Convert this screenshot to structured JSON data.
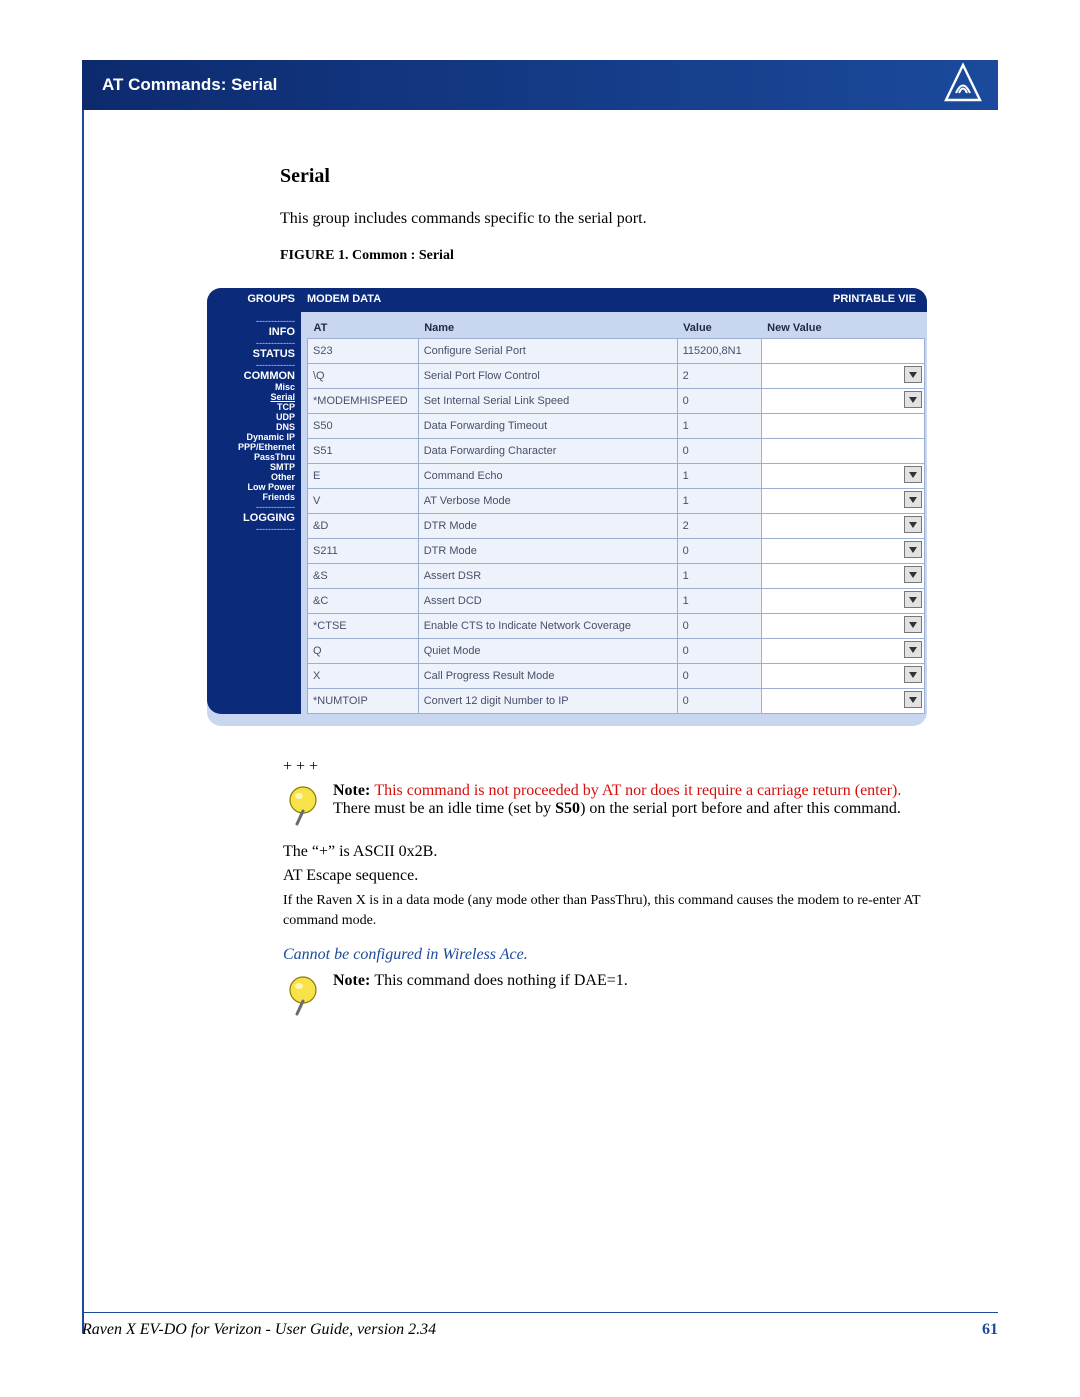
{
  "header": {
    "title": "AT Commands: Serial"
  },
  "section": {
    "heading": "Serial",
    "intro": "This group includes commands specific to the serial port.",
    "figure_label": "FIGURE 1.",
    "figure_title": "Common : Serial"
  },
  "screenshot": {
    "groups_header": "GROUPS",
    "modem_header": "MODEM DATA",
    "printable_header": "PRINTABLE VIE",
    "nav": [
      "INFO",
      "STATUS",
      "COMMON",
      "Misc",
      "Serial",
      "TCP",
      "UDP",
      "DNS",
      "Dynamic IP",
      "PPP/Ethernet",
      "PassThru",
      "SMTP",
      "Other",
      "Low Power",
      "Friends",
      "LOGGING"
    ],
    "columns": {
      "at": "AT",
      "name": "Name",
      "value": "Value",
      "new": "New Value"
    },
    "rows": [
      {
        "at": "S23",
        "name": "Configure Serial Port",
        "value": "115200,8N1",
        "dropdown": false
      },
      {
        "at": "\\Q",
        "name": "Serial Port Flow Control",
        "value": "2",
        "dropdown": true
      },
      {
        "at": "*MODEMHISPEED",
        "name": "Set Internal Serial Link Speed",
        "value": "0",
        "dropdown": true
      },
      {
        "at": "S50",
        "name": "Data Forwarding Timeout",
        "value": "1",
        "dropdown": false
      },
      {
        "at": "S51",
        "name": "Data Forwarding Character",
        "value": "0",
        "dropdown": false
      },
      {
        "at": "E",
        "name": "Command Echo",
        "value": "1",
        "dropdown": true
      },
      {
        "at": "V",
        "name": "AT Verbose Mode",
        "value": "1",
        "dropdown": true
      },
      {
        "at": "&D",
        "name": "DTR Mode",
        "value": "2",
        "dropdown": true
      },
      {
        "at": "S211",
        "name": "DTR Mode",
        "value": "0",
        "dropdown": true
      },
      {
        "at": "&S",
        "name": "Assert DSR",
        "value": "1",
        "dropdown": true
      },
      {
        "at": "&C",
        "name": "Assert DCD",
        "value": "1",
        "dropdown": true
      },
      {
        "at": "*CTSE",
        "name": "Enable CTS to Indicate Network Coverage",
        "value": "0",
        "dropdown": true
      },
      {
        "at": "Q",
        "name": "Quiet Mode",
        "value": "0",
        "dropdown": true
      },
      {
        "at": "X",
        "name": "Call Progress Result Mode",
        "value": "0",
        "dropdown": true
      },
      {
        "at": "*NUMTOIP",
        "name": "Convert 12 digit Number to IP",
        "value": "0",
        "dropdown": true
      }
    ]
  },
  "notes": {
    "plus": "+ + +",
    "note1_bold": "Note: ",
    "note1_red": "This command is not proceeded by AT nor does it require a carriage return (enter).",
    "note1_after_a": "There must be an idle time (set by ",
    "note1_s50": "S50",
    "note1_after_b": ") on the serial port before and after this command.",
    "line_ascii": "The “+” is ASCII 0x2B.",
    "line_escape": "AT Escape sequence.",
    "line_small": "If the Raven X is in a data mode (any mode other than PassThru), this command causes the modem to re-enter AT command mode.",
    "cannot": "Cannot be configured in Wireless Ace.",
    "note2_bold": "Note: ",
    "note2_text": "This command does nothing if DAE=1."
  },
  "footer": {
    "doc": "Raven X EV-DO for Verizon - User Guide, version 2.34",
    "page": "61"
  }
}
